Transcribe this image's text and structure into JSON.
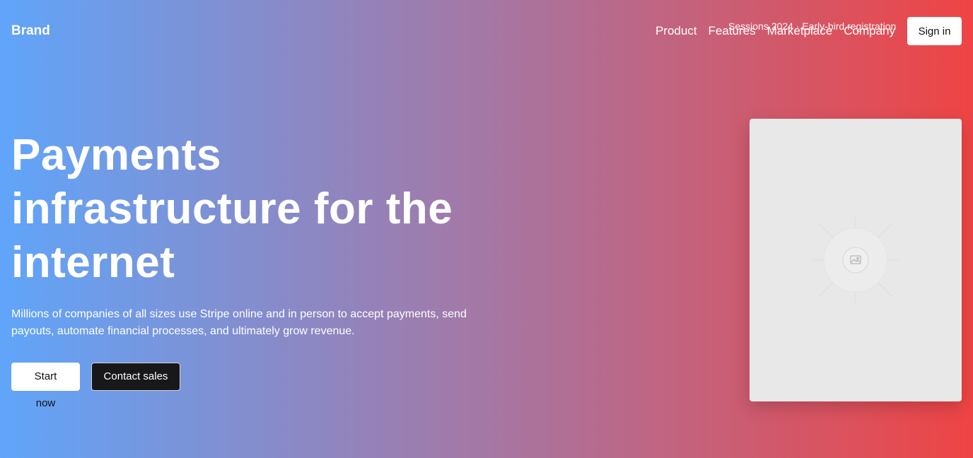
{
  "header": {
    "brand": "Brand",
    "nav": [
      "Product",
      "Features",
      "Marketplace",
      "Company"
    ],
    "announcement": "Sessions 2024 · Early-bird registration",
    "signin_label": "Sign in"
  },
  "hero": {
    "title": "Payments infrastructure for the internet",
    "subtitle": "Millions of companies of all sizes use Stripe online and in person to accept payments, send payouts, automate financial processes, and ultimately grow revenue.",
    "primary_cta": "Start now",
    "secondary_cta": "Contact sales"
  },
  "media": {
    "icon": "image-placeholder-icon"
  },
  "colors": {
    "gradient_start": "#60a5fa",
    "gradient_mid": "#a577a4",
    "gradient_end": "#ef4444",
    "card_bg": "#e8e8e8",
    "dark_button": "#18181b"
  }
}
